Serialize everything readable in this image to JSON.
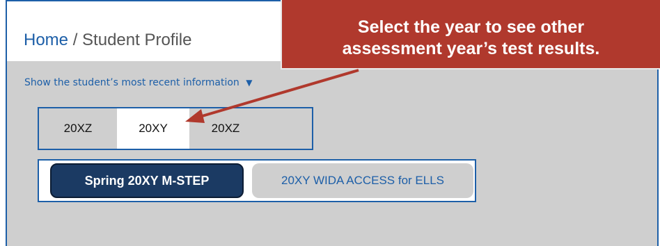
{
  "breadcrumb": {
    "home_label": "Home",
    "separator": "/",
    "current_label": "Student Profile"
  },
  "recent_info": {
    "label": "Show the student’s most recent information",
    "caret": "▼"
  },
  "year_tabs": [
    {
      "label": "20XZ",
      "selected": false
    },
    {
      "label": "20XY",
      "selected": true
    },
    {
      "label": "20XZ",
      "selected": false
    }
  ],
  "assessment_tabs": [
    {
      "label": "Spring 20XY M-STEP",
      "selected": true
    },
    {
      "label": "20XY WIDA ACCESS for ELLS",
      "selected": false
    }
  ],
  "callout": {
    "line1": "Select the year to see other",
    "line2": "assessment year’s test results."
  },
  "colors": {
    "accent_blue": "#1d5fa8",
    "selected_tab_navy": "#1b3a63",
    "callout_red": "#b0392d",
    "panel_gray": "#cfcfcf"
  }
}
